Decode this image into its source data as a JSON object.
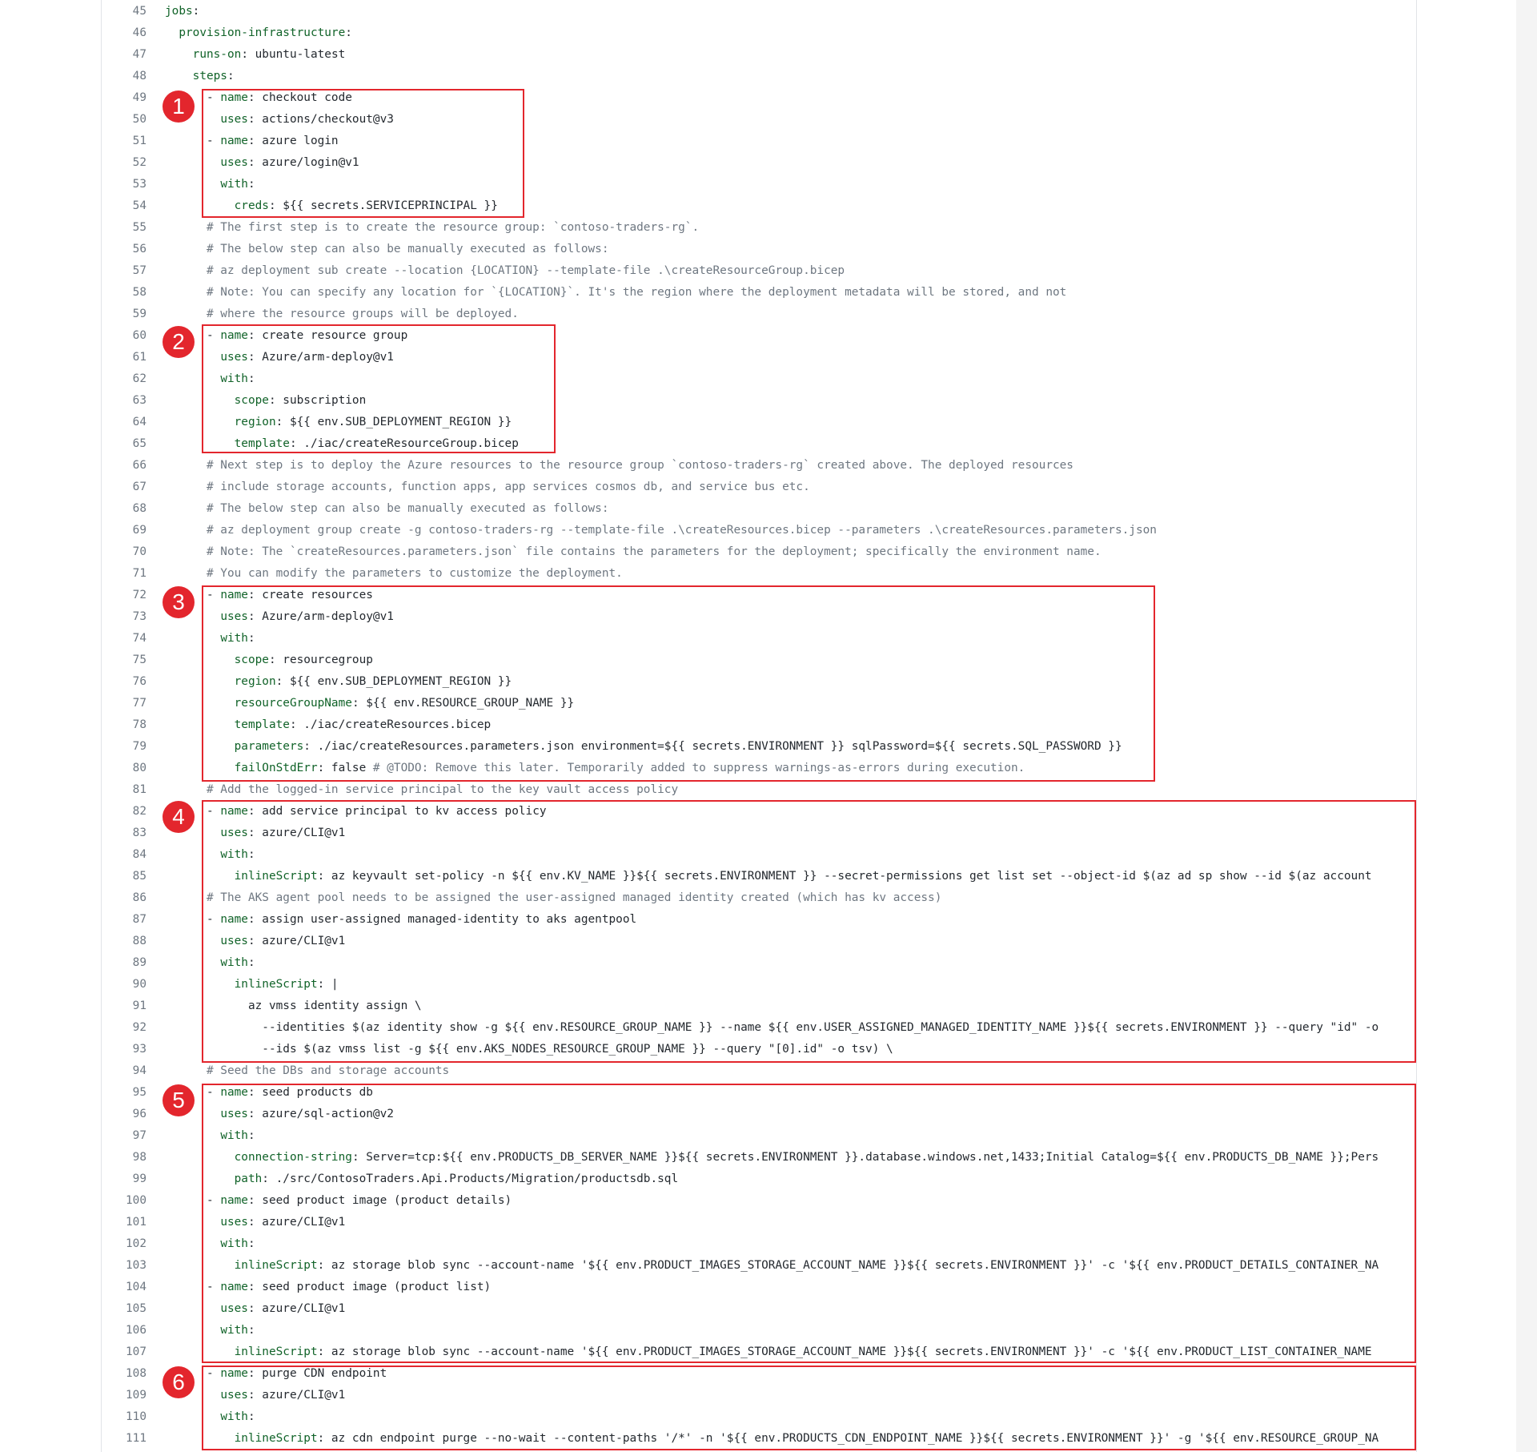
{
  "lines": [
    {
      "n": "45",
      "t": "jobs:"
    },
    {
      "n": "46",
      "t": "  provision-infrastructure:"
    },
    {
      "n": "47",
      "t": "    runs-on: ubuntu-latest"
    },
    {
      "n": "48",
      "t": "    steps:"
    },
    {
      "n": "49",
      "t": "      - name: checkout code"
    },
    {
      "n": "50",
      "t": "        uses: actions/checkout@v3"
    },
    {
      "n": "51",
      "t": "      - name: azure login"
    },
    {
      "n": "52",
      "t": "        uses: azure/login@v1"
    },
    {
      "n": "53",
      "t": "        with:"
    },
    {
      "n": "54",
      "t": "          creds: ${{ secrets.SERVICEPRINCIPAL }}"
    },
    {
      "n": "55",
      "t": "      # The first step is to create the resource group: `contoso-traders-rg`."
    },
    {
      "n": "56",
      "t": "      # The below step can also be manually executed as follows:"
    },
    {
      "n": "57",
      "t": "      # az deployment sub create --location {LOCATION} --template-file .\\createResourceGroup.bicep"
    },
    {
      "n": "58",
      "t": "      # Note: You can specify any location for `{LOCATION}`. It's the region where the deployment metadata will be stored, and not"
    },
    {
      "n": "59",
      "t": "      # where the resource groups will be deployed."
    },
    {
      "n": "60",
      "t": "      - name: create resource group"
    },
    {
      "n": "61",
      "t": "        uses: Azure/arm-deploy@v1"
    },
    {
      "n": "62",
      "t": "        with:"
    },
    {
      "n": "63",
      "t": "          scope: subscription"
    },
    {
      "n": "64",
      "t": "          region: ${{ env.SUB_DEPLOYMENT_REGION }}"
    },
    {
      "n": "65",
      "t": "          template: ./iac/createResourceGroup.bicep"
    },
    {
      "n": "66",
      "t": "      # Next step is to deploy the Azure resources to the resource group `contoso-traders-rg` created above. The deployed resources"
    },
    {
      "n": "67",
      "t": "      # include storage accounts, function apps, app services cosmos db, and service bus etc."
    },
    {
      "n": "68",
      "t": "      # The below step can also be manually executed as follows:"
    },
    {
      "n": "69",
      "t": "      # az deployment group create -g contoso-traders-rg --template-file .\\createResources.bicep --parameters .\\createResources.parameters.json"
    },
    {
      "n": "70",
      "t": "      # Note: The `createResources.parameters.json` file contains the parameters for the deployment; specifically the environment name."
    },
    {
      "n": "71",
      "t": "      # You can modify the parameters to customize the deployment."
    },
    {
      "n": "72",
      "t": "      - name: create resources"
    },
    {
      "n": "73",
      "t": "        uses: Azure/arm-deploy@v1"
    },
    {
      "n": "74",
      "t": "        with:"
    },
    {
      "n": "75",
      "t": "          scope: resourcegroup"
    },
    {
      "n": "76",
      "t": "          region: ${{ env.SUB_DEPLOYMENT_REGION }}"
    },
    {
      "n": "77",
      "t": "          resourceGroupName: ${{ env.RESOURCE_GROUP_NAME }}"
    },
    {
      "n": "78",
      "t": "          template: ./iac/createResources.bicep"
    },
    {
      "n": "79",
      "t": "          parameters: ./iac/createResources.parameters.json environment=${{ secrets.ENVIRONMENT }} sqlPassword=${{ secrets.SQL_PASSWORD }}"
    },
    {
      "n": "80",
      "t": "          failOnStdErr: false # @TODO: Remove this later. Temporarily added to suppress warnings-as-errors during execution."
    },
    {
      "n": "81",
      "t": "      # Add the logged-in service principal to the key vault access policy"
    },
    {
      "n": "82",
      "t": "      - name: add service principal to kv access policy"
    },
    {
      "n": "83",
      "t": "        uses: azure/CLI@v1"
    },
    {
      "n": "84",
      "t": "        with:"
    },
    {
      "n": "85",
      "t": "          inlineScript: az keyvault set-policy -n ${{ env.KV_NAME }}${{ secrets.ENVIRONMENT }} --secret-permissions get list set --object-id $(az ad sp show --id $(az account"
    },
    {
      "n": "86",
      "t": "      # The AKS agent pool needs to be assigned the user-assigned managed identity created (which has kv access)"
    },
    {
      "n": "87",
      "t": "      - name: assign user-assigned managed-identity to aks agentpool"
    },
    {
      "n": "88",
      "t": "        uses: azure/CLI@v1"
    },
    {
      "n": "89",
      "t": "        with:"
    },
    {
      "n": "90",
      "t": "          inlineScript: |"
    },
    {
      "n": "91",
      "t": "            az vmss identity assign \\"
    },
    {
      "n": "92",
      "t": "              --identities $(az identity show -g ${{ env.RESOURCE_GROUP_NAME }} --name ${{ env.USER_ASSIGNED_MANAGED_IDENTITY_NAME }}${{ secrets.ENVIRONMENT }} --query \"id\" -o"
    },
    {
      "n": "93",
      "t": "              --ids $(az vmss list -g ${{ env.AKS_NODES_RESOURCE_GROUP_NAME }} --query \"[0].id\" -o tsv) \\"
    },
    {
      "n": "94",
      "t": "      # Seed the DBs and storage accounts"
    },
    {
      "n": "95",
      "t": "      - name: seed products db"
    },
    {
      "n": "96",
      "t": "        uses: azure/sql-action@v2"
    },
    {
      "n": "97",
      "t": "        with:"
    },
    {
      "n": "98",
      "t": "          connection-string: Server=tcp:${{ env.PRODUCTS_DB_SERVER_NAME }}${{ secrets.ENVIRONMENT }}.database.windows.net,1433;Initial Catalog=${{ env.PRODUCTS_DB_NAME }};Pers"
    },
    {
      "n": "99",
      "t": "          path: ./src/ContosoTraders.Api.Products/Migration/productsdb.sql"
    },
    {
      "n": "100",
      "t": "      - name: seed product image (product details)"
    },
    {
      "n": "101",
      "t": "        uses: azure/CLI@v1"
    },
    {
      "n": "102",
      "t": "        with:"
    },
    {
      "n": "103",
      "t": "          inlineScript: az storage blob sync --account-name '${{ env.PRODUCT_IMAGES_STORAGE_ACCOUNT_NAME }}${{ secrets.ENVIRONMENT }}' -c '${{ env.PRODUCT_DETAILS_CONTAINER_NA"
    },
    {
      "n": "104",
      "t": "      - name: seed product image (product list)"
    },
    {
      "n": "105",
      "t": "        uses: azure/CLI@v1"
    },
    {
      "n": "106",
      "t": "        with:"
    },
    {
      "n": "107",
      "t": "          inlineScript: az storage blob sync --account-name '${{ env.PRODUCT_IMAGES_STORAGE_ACCOUNT_NAME }}${{ secrets.ENVIRONMENT }}' -c '${{ env.PRODUCT_LIST_CONTAINER_NAME"
    },
    {
      "n": "108",
      "t": "      - name: purge CDN endpoint"
    },
    {
      "n": "109",
      "t": "        uses: azure/CLI@v1"
    },
    {
      "n": "110",
      "t": "        with:"
    },
    {
      "n": "111",
      "t": "          inlineScript: az cdn endpoint purge --no-wait --content-paths '/*' -n '${{ env.PRODUCTS_CDN_ENDPOINT_NAME }}${{ secrets.ENVIRONMENT }}' -g '${{ env.RESOURCE_GROUP_NA"
    }
  ],
  "annotations": [
    {
      "label": "1"
    },
    {
      "label": "2"
    },
    {
      "label": "3"
    },
    {
      "label": "4"
    },
    {
      "label": "5"
    },
    {
      "label": "6"
    }
  ],
  "colors": {
    "annotation": "#e3262d",
    "key": "#116329",
    "comment": "#6e7781",
    "text": "#24292f"
  }
}
